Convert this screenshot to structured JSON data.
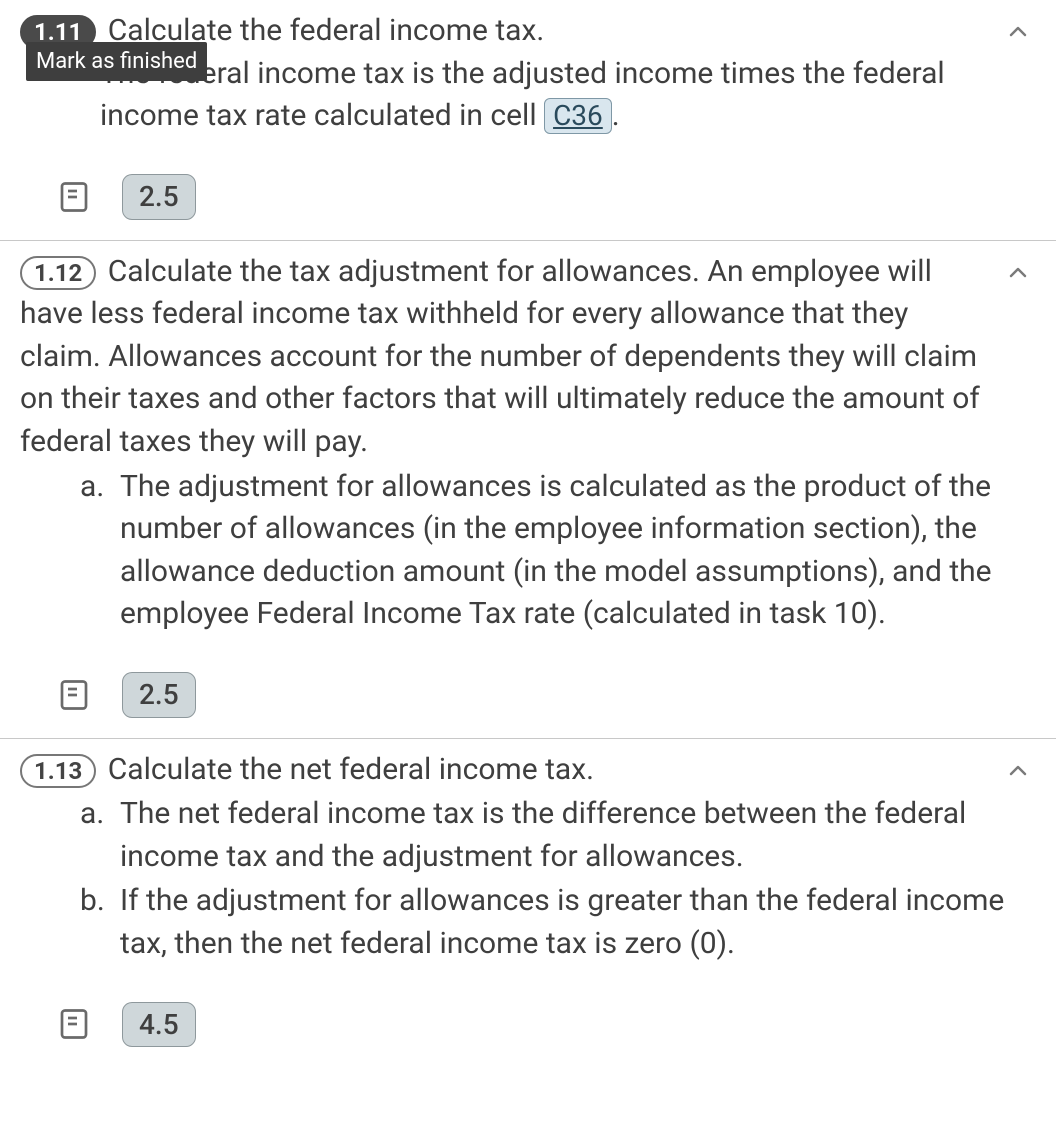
{
  "tasks": [
    {
      "num": "1.11",
      "active": true,
      "title": "Calculate the federal income tax.",
      "tooltip": "Mark as finished",
      "body_prefix": "The federal income tax is the adjusted income times the federal income tax rate calculated in cell ",
      "cell_ref": "C36",
      "body_suffix": ".",
      "subs": [],
      "points": "2.5"
    },
    {
      "num": "1.12",
      "active": false,
      "title": "Calculate the tax adjustment for allowances. An employee will have less federal income tax withheld for every allowance that they claim. Allowances account for the number of dependents they will claim on their taxes and other factors that will ultimately reduce the amount of federal taxes they will pay.",
      "subs": [
        {
          "marker": "a.",
          "text": "The adjustment for allowances is calculated as the product of the number of allowances (in the employee information section), the allowance deduction amount (in the model assumptions), and the employee Federal Income Tax rate (calculated in task 10)."
        }
      ],
      "points": "2.5"
    },
    {
      "num": "1.13",
      "active": false,
      "title": "Calculate the net federal income tax.",
      "subs": [
        {
          "marker": "a.",
          "text": "The net federal income tax is the difference between the federal income tax and the adjustment for allowances."
        },
        {
          "marker": "b.",
          "text": "If the adjustment for allowances is greater than the federal income tax, then the net federal income tax is zero (0)."
        }
      ],
      "points": "4.5"
    }
  ]
}
